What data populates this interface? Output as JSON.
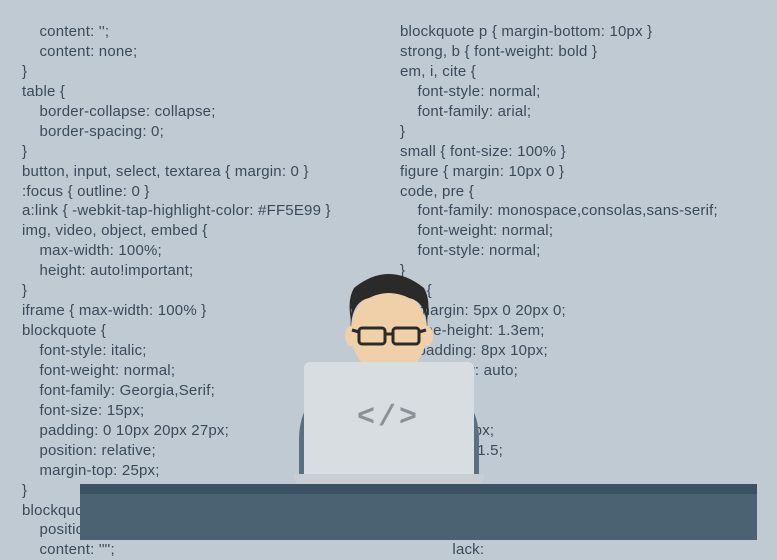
{
  "code": {
    "left": "    content: '';\n    content: none;\n}\ntable {\n    border-collapse: collapse;\n    border-spacing: 0;\n}\nbutton, input, select, textarea { margin: 0 }\n:focus { outline: 0 }\na:link { -webkit-tap-highlight-color: #FF5E99 }\nimg, video, object, embed {\n    max-width: 100%;\n    height: auto!important;\n}\niframe { max-width: 100% }\nblockquote {\n    font-style: italic;\n    font-weight: normal;\n    font-family: Georgia,Serif;\n    font-size: 15px;\n    padding: 0 10px 20px 27px;\n    position: relative;\n    margin-top: 25px;\n}\nblockquote:after {\n    position: absolute;\n    content: '\"';",
    "right": "blockquote p { margin-bottom: 10px }\nstrong, b { font-weight: bold }\nem, i, cite {\n    font-style: normal;\n    font-family: arial;\n}\nsmall { font-size: 100% }\nfigure { margin: 10px 0 }\ncode, pre {\n    font-family: monospace,consolas,sans-serif;\n    font-weight: normal;\n    font-style: normal;\n}\npre {\n    margin: 5px 0 20px 0;\n    line-height: 1.3em;\n    padding: 8px 10px;\n    overflow: auto;\n}\n   {\n        g: 0 8px;\n        eight: 1.5;\n\n\n        : 1px 6px;\n     line-height:\n            lack:"
  },
  "laptop": {
    "icon": "</>"
  }
}
